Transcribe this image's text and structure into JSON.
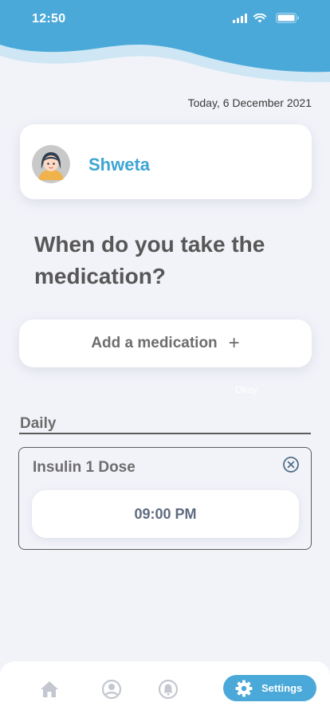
{
  "status_bar": {
    "time": "12:50"
  },
  "header": {
    "date": "Today, 6 December 2021"
  },
  "profile": {
    "name": "Shweta"
  },
  "main": {
    "question": "When do you take the medication?",
    "add_button_label": "Add a medication",
    "add_button_icon": "plus-icon",
    "ghost_text": "Okay"
  },
  "schedule": {
    "section_label": "Daily",
    "medications": [
      {
        "name": "Insulin 1 Dose",
        "time": "09:00 PM"
      }
    ]
  },
  "nav": {
    "items": [
      "home-icon",
      "profile-icon",
      "bell-icon"
    ],
    "settings_label": "Settings"
  },
  "colors": {
    "accent": "#3fa5d3",
    "wave_dark": "#4aa9d9",
    "wave_light": "#cfe6f4",
    "background": "#f2f3f9"
  }
}
